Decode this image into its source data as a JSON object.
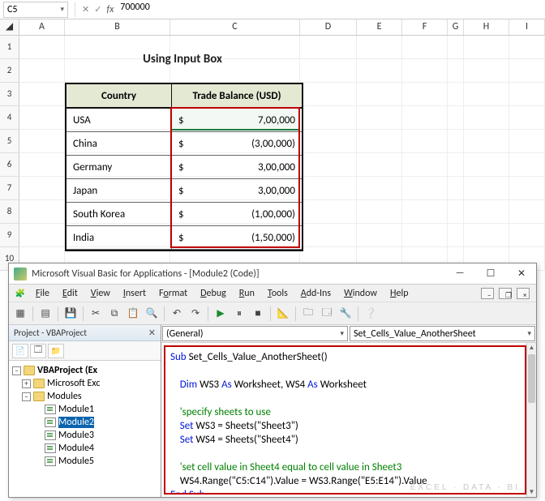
{
  "excel": {
    "nameBox": "C5",
    "formula": "700000",
    "cols": [
      "A",
      "B",
      "C",
      "D",
      "E",
      "F",
      "G",
      "H",
      "I"
    ],
    "rowNums": [
      1,
      2,
      3,
      4,
      5,
      6,
      7,
      8,
      9,
      10
    ],
    "title": "Using Input Box",
    "headers": {
      "country": "Country",
      "balance": "Trade Balance (USD)"
    },
    "currency": "$",
    "data": [
      {
        "country": "USA",
        "amount": "7,00,000"
      },
      {
        "country": "China",
        "amount": "(3,00,000)"
      },
      {
        "country": "Germany",
        "amount": "3,00,000"
      },
      {
        "country": "Japan",
        "amount": "3,00,000"
      },
      {
        "country": "South Korea",
        "amount": "(1,00,000)"
      },
      {
        "country": "India",
        "amount": "(1,50,000)"
      }
    ]
  },
  "vba": {
    "title": "Microsoft Visual Basic for Applications - [Module2 (Code)]",
    "menu": [
      "File",
      "Edit",
      "View",
      "Insert",
      "Format",
      "Debug",
      "Run",
      "Tools",
      "Add-Ins",
      "Window",
      "Help"
    ],
    "projectTitle": "Project - VBAProject",
    "tree": {
      "root": "VBAProject (Ex",
      "msExcel": "Microsoft Exc",
      "modulesFolder": "Modules",
      "modules": [
        "Module1",
        "Module2",
        "Module3",
        "Module4",
        "Module5"
      ],
      "selected": "Module2"
    },
    "dropLeft": "(General)",
    "dropRight": "Set_Cells_Value_AnotherSheet",
    "code": {
      "l1a": "Sub",
      "l1b": " Set_Cells_Value_AnotherSheet()",
      "l2a": "    Dim",
      "l2b": " WS3 ",
      "l2c": "As",
      "l2d": " Worksheet, WS4 ",
      "l2e": "As",
      "l2f": " Worksheet",
      "l3": "    'specify sheets to use",
      "l4a": "    Set",
      "l4b": " WS3 = Sheets(\"Sheet3\")",
      "l5a": "    Set",
      "l5b": " WS4 = Sheets(\"Sheet4\")",
      "l6": "    'set cell value in Sheet4 equal to cell value in Sheet3",
      "l7": "    WS4.Range(\"C5:C14\").Value = WS3.Range(\"E5:E14\").Value",
      "l8": "End Sub"
    },
    "watermark": "EXCEL · DATA · BI"
  }
}
